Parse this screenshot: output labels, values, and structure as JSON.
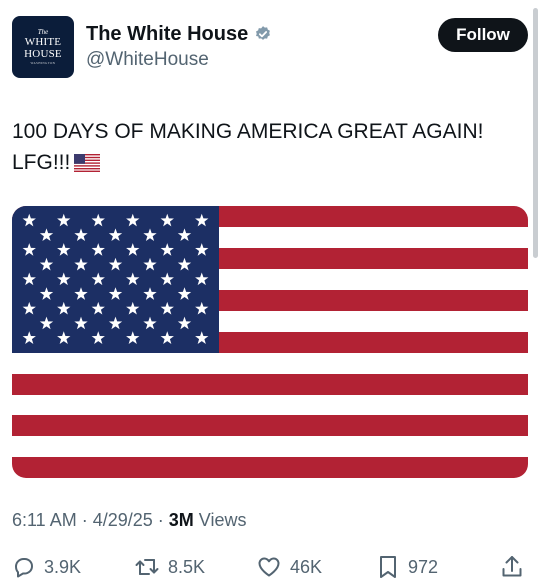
{
  "author": {
    "display_name": "The White House",
    "handle": "@WhiteHouse",
    "avatar_text": {
      "line1": "The",
      "line2": "WHITE",
      "line3": "HOUSE",
      "line4": "WASHINGTON"
    }
  },
  "follow_label": "Follow",
  "tweet": {
    "line1": "100 DAYS OF MAKING AMERICA GREAT AGAIN!",
    "line2": "LFG!!!",
    "emoji_icon": "us-flag-emoji"
  },
  "media": {
    "icon": "american-flag-image",
    "colors": {
      "red": "#b22234",
      "blue": "#1c2f64",
      "white": "#ffffff"
    }
  },
  "meta": {
    "time": "6:11 AM",
    "date": "4/29/25",
    "views_count": "3M",
    "views_label": "Views"
  },
  "actions": {
    "replies": "3.9K",
    "reposts": "8.5K",
    "likes": "46K",
    "bookmarks": "972"
  },
  "colors": {
    "verified": "#829aab",
    "text": "#0f1419",
    "secondary": "#536471"
  }
}
